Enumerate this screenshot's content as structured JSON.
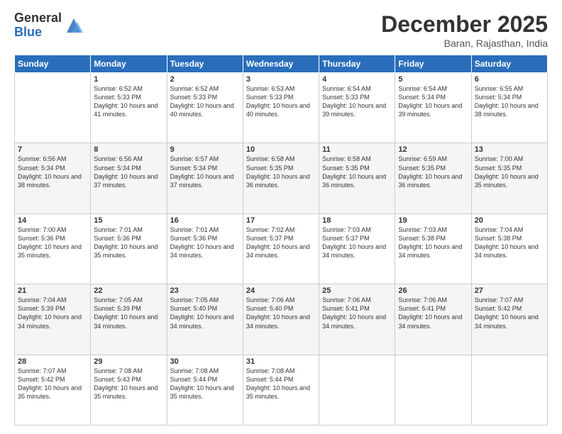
{
  "header": {
    "logo_general": "General",
    "logo_blue": "Blue",
    "month_title": "December 2025",
    "subtitle": "Baran, Rajasthan, India"
  },
  "weekdays": [
    "Sunday",
    "Monday",
    "Tuesday",
    "Wednesday",
    "Thursday",
    "Friday",
    "Saturday"
  ],
  "weeks": [
    [
      {
        "day": "",
        "sunrise": "",
        "sunset": "",
        "daylight": ""
      },
      {
        "day": "1",
        "sunrise": "Sunrise: 6:52 AM",
        "sunset": "Sunset: 5:33 PM",
        "daylight": "Daylight: 10 hours and 41 minutes."
      },
      {
        "day": "2",
        "sunrise": "Sunrise: 6:52 AM",
        "sunset": "Sunset: 5:33 PM",
        "daylight": "Daylight: 10 hours and 40 minutes."
      },
      {
        "day": "3",
        "sunrise": "Sunrise: 6:53 AM",
        "sunset": "Sunset: 5:33 PM",
        "daylight": "Daylight: 10 hours and 40 minutes."
      },
      {
        "day": "4",
        "sunrise": "Sunrise: 6:54 AM",
        "sunset": "Sunset: 5:33 PM",
        "daylight": "Daylight: 10 hours and 39 minutes."
      },
      {
        "day": "5",
        "sunrise": "Sunrise: 6:54 AM",
        "sunset": "Sunset: 5:34 PM",
        "daylight": "Daylight: 10 hours and 39 minutes."
      },
      {
        "day": "6",
        "sunrise": "Sunrise: 6:55 AM",
        "sunset": "Sunset: 5:34 PM",
        "daylight": "Daylight: 10 hours and 38 minutes."
      }
    ],
    [
      {
        "day": "7",
        "sunrise": "Sunrise: 6:56 AM",
        "sunset": "Sunset: 5:34 PM",
        "daylight": "Daylight: 10 hours and 38 minutes."
      },
      {
        "day": "8",
        "sunrise": "Sunrise: 6:56 AM",
        "sunset": "Sunset: 5:34 PM",
        "daylight": "Daylight: 10 hours and 37 minutes."
      },
      {
        "day": "9",
        "sunrise": "Sunrise: 6:57 AM",
        "sunset": "Sunset: 5:34 PM",
        "daylight": "Daylight: 10 hours and 37 minutes."
      },
      {
        "day": "10",
        "sunrise": "Sunrise: 6:58 AM",
        "sunset": "Sunset: 5:35 PM",
        "daylight": "Daylight: 10 hours and 36 minutes."
      },
      {
        "day": "11",
        "sunrise": "Sunrise: 6:58 AM",
        "sunset": "Sunset: 5:35 PM",
        "daylight": "Daylight: 10 hours and 36 minutes."
      },
      {
        "day": "12",
        "sunrise": "Sunrise: 6:59 AM",
        "sunset": "Sunset: 5:35 PM",
        "daylight": "Daylight: 10 hours and 36 minutes."
      },
      {
        "day": "13",
        "sunrise": "Sunrise: 7:00 AM",
        "sunset": "Sunset: 5:35 PM",
        "daylight": "Daylight: 10 hours and 35 minutes."
      }
    ],
    [
      {
        "day": "14",
        "sunrise": "Sunrise: 7:00 AM",
        "sunset": "Sunset: 5:36 PM",
        "daylight": "Daylight: 10 hours and 35 minutes."
      },
      {
        "day": "15",
        "sunrise": "Sunrise: 7:01 AM",
        "sunset": "Sunset: 5:36 PM",
        "daylight": "Daylight: 10 hours and 35 minutes."
      },
      {
        "day": "16",
        "sunrise": "Sunrise: 7:01 AM",
        "sunset": "Sunset: 5:36 PM",
        "daylight": "Daylight: 10 hours and 34 minutes."
      },
      {
        "day": "17",
        "sunrise": "Sunrise: 7:02 AM",
        "sunset": "Sunset: 5:37 PM",
        "daylight": "Daylight: 10 hours and 34 minutes."
      },
      {
        "day": "18",
        "sunrise": "Sunrise: 7:03 AM",
        "sunset": "Sunset: 5:37 PM",
        "daylight": "Daylight: 10 hours and 34 minutes."
      },
      {
        "day": "19",
        "sunrise": "Sunrise: 7:03 AM",
        "sunset": "Sunset: 5:38 PM",
        "daylight": "Daylight: 10 hours and 34 minutes."
      },
      {
        "day": "20",
        "sunrise": "Sunrise: 7:04 AM",
        "sunset": "Sunset: 5:38 PM",
        "daylight": "Daylight: 10 hours and 34 minutes."
      }
    ],
    [
      {
        "day": "21",
        "sunrise": "Sunrise: 7:04 AM",
        "sunset": "Sunset: 5:39 PM",
        "daylight": "Daylight: 10 hours and 34 minutes."
      },
      {
        "day": "22",
        "sunrise": "Sunrise: 7:05 AM",
        "sunset": "Sunset: 5:39 PM",
        "daylight": "Daylight: 10 hours and 34 minutes."
      },
      {
        "day": "23",
        "sunrise": "Sunrise: 7:05 AM",
        "sunset": "Sunset: 5:40 PM",
        "daylight": "Daylight: 10 hours and 34 minutes."
      },
      {
        "day": "24",
        "sunrise": "Sunrise: 7:06 AM",
        "sunset": "Sunset: 5:40 PM",
        "daylight": "Daylight: 10 hours and 34 minutes."
      },
      {
        "day": "25",
        "sunrise": "Sunrise: 7:06 AM",
        "sunset": "Sunset: 5:41 PM",
        "daylight": "Daylight: 10 hours and 34 minutes."
      },
      {
        "day": "26",
        "sunrise": "Sunrise: 7:06 AM",
        "sunset": "Sunset: 5:41 PM",
        "daylight": "Daylight: 10 hours and 34 minutes."
      },
      {
        "day": "27",
        "sunrise": "Sunrise: 7:07 AM",
        "sunset": "Sunset: 5:42 PM",
        "daylight": "Daylight: 10 hours and 34 minutes."
      }
    ],
    [
      {
        "day": "28",
        "sunrise": "Sunrise: 7:07 AM",
        "sunset": "Sunset: 5:42 PM",
        "daylight": "Daylight: 10 hours and 35 minutes."
      },
      {
        "day": "29",
        "sunrise": "Sunrise: 7:08 AM",
        "sunset": "Sunset: 5:43 PM",
        "daylight": "Daylight: 10 hours and 35 minutes."
      },
      {
        "day": "30",
        "sunrise": "Sunrise: 7:08 AM",
        "sunset": "Sunset: 5:44 PM",
        "daylight": "Daylight: 10 hours and 35 minutes."
      },
      {
        "day": "31",
        "sunrise": "Sunrise: 7:08 AM",
        "sunset": "Sunset: 5:44 PM",
        "daylight": "Daylight: 10 hours and 35 minutes."
      },
      {
        "day": "",
        "sunrise": "",
        "sunset": "",
        "daylight": ""
      },
      {
        "day": "",
        "sunrise": "",
        "sunset": "",
        "daylight": ""
      },
      {
        "day": "",
        "sunrise": "",
        "sunset": "",
        "daylight": ""
      }
    ]
  ]
}
